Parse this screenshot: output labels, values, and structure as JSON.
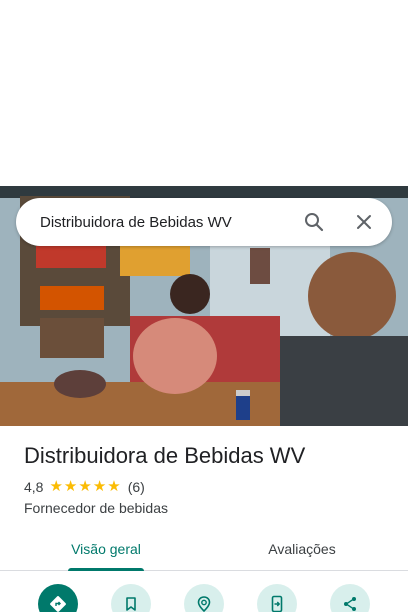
{
  "search": {
    "query": "Distribuidora de Bebidas WV"
  },
  "place": {
    "name": "Distribuidora de Bebidas WV",
    "rating": "4,8",
    "stars": 5,
    "review_count": "(6)",
    "category": "Fornecedor de bebidas"
  },
  "tabs": [
    {
      "label": "Visão geral",
      "active": true
    },
    {
      "label": "Avaliações",
      "active": false
    }
  ],
  "actions": [
    {
      "icon": "directions-icon"
    },
    {
      "icon": "bookmark-icon"
    },
    {
      "icon": "nearby-icon"
    },
    {
      "icon": "send-to-phone-icon"
    },
    {
      "icon": "share-icon"
    }
  ],
  "colors": {
    "accent": "#00796b",
    "star": "#fbbc04",
    "chip": "#d8efec"
  }
}
